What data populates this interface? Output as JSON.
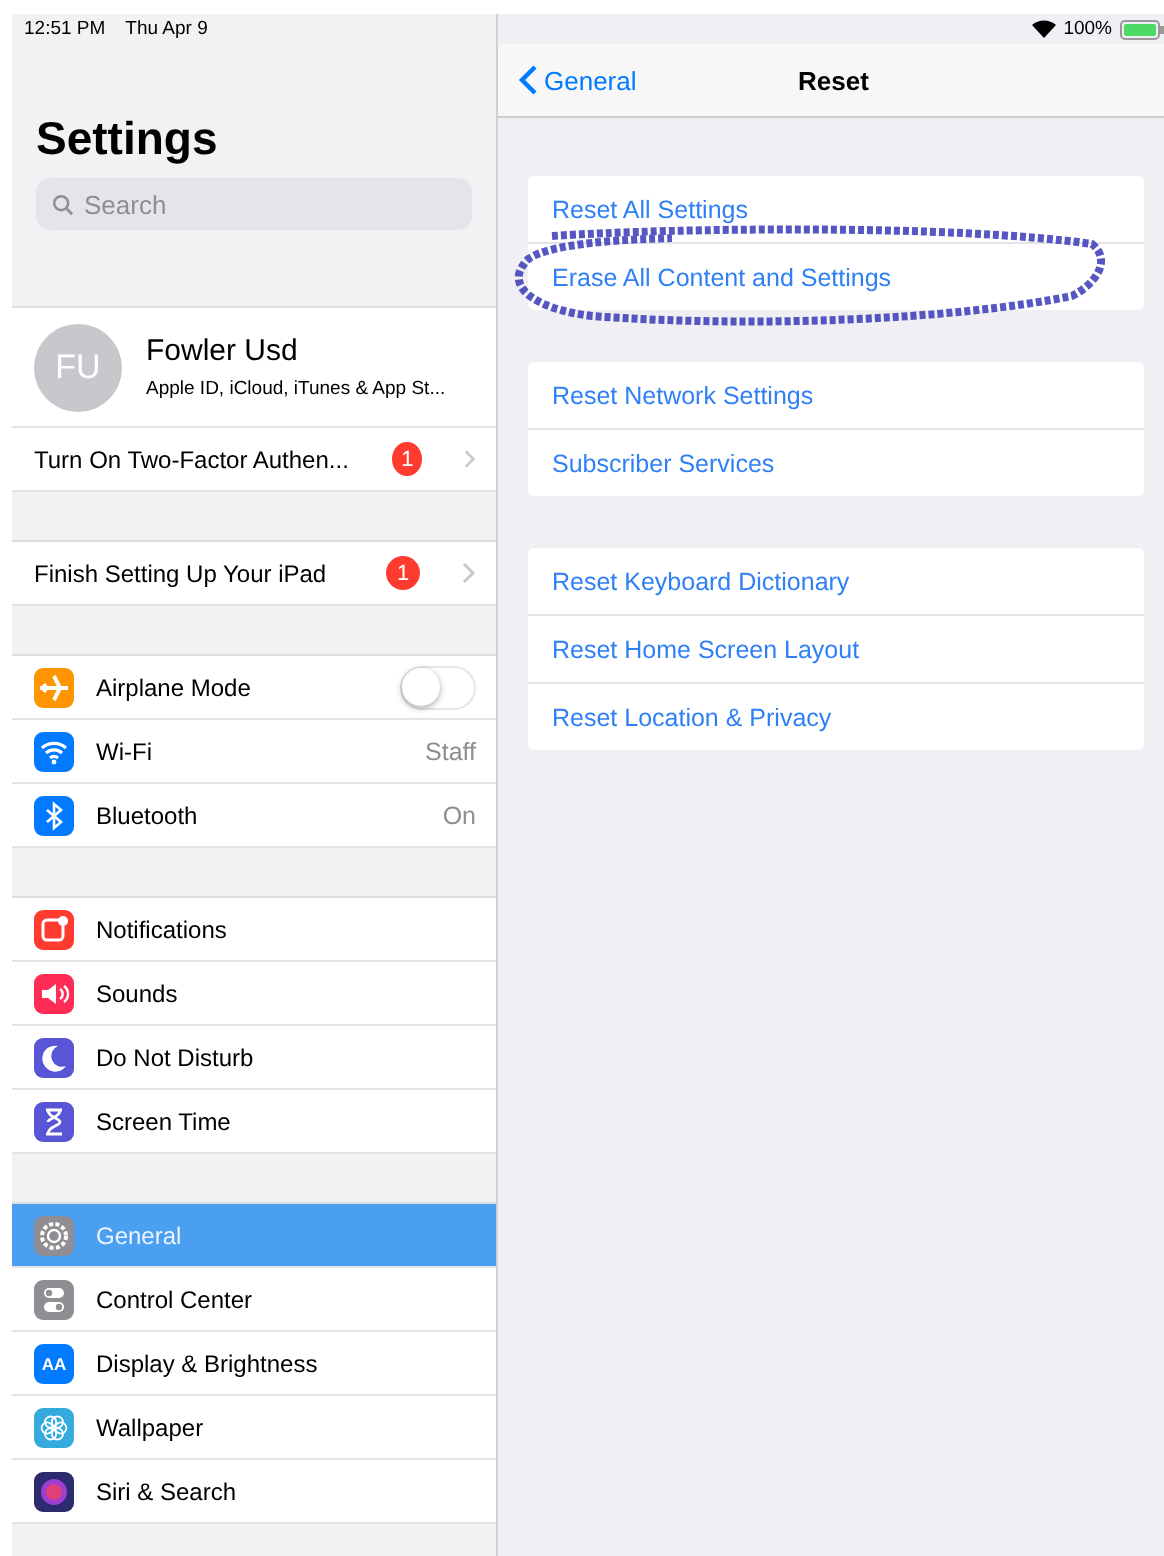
{
  "status_bar": {
    "time": "12:51 PM",
    "date": "Thu Apr 9",
    "battery": "100%"
  },
  "sidebar": {
    "title": "Settings",
    "search": {
      "placeholder": "Search"
    },
    "groups": [
      {
        "items": [
          {
            "kind": "profile",
            "initials": "FU",
            "name": "Fowler Usd",
            "subtitle": "Apple ID, iCloud, iTunes & App St...",
            "selected": false
          },
          {
            "kind": "badge",
            "label": "Turn On Two-Factor Authen...",
            "badge": "1",
            "selected": false
          }
        ]
      },
      {
        "items": [
          {
            "kind": "badge",
            "label": "Finish Setting Up Your iPad",
            "badge": "1",
            "selected": false
          }
        ]
      },
      {
        "items": [
          {
            "kind": "toggle",
            "label": "Airplane Mode",
            "color": "#ff9500",
            "on": false,
            "selected": false
          },
          {
            "kind": "value",
            "label": "Wi-Fi",
            "color": "#007aff",
            "value": "Staff",
            "selected": false
          },
          {
            "kind": "value",
            "label": "Bluetooth",
            "color": "#007aff",
            "value": "On",
            "selected": false
          }
        ]
      },
      {
        "items": [
          {
            "kind": "link",
            "label": "Notifications",
            "color": "#ff3b30",
            "selected": false
          },
          {
            "kind": "link",
            "label": "Sounds",
            "color": "#ff2d55",
            "selected": false
          },
          {
            "kind": "link",
            "label": "Do Not Disturb",
            "color": "#5856d6",
            "selected": false
          },
          {
            "kind": "link",
            "label": "Screen Time",
            "color": "#5856d6",
            "selected": false
          }
        ]
      },
      {
        "items": [
          {
            "kind": "link",
            "label": "General",
            "color": "#8e8e93",
            "selected": true
          },
          {
            "kind": "link",
            "label": "Control Center",
            "color": "#8e8e93",
            "selected": false
          },
          {
            "kind": "link",
            "label": "Display & Brightness",
            "color": "#007aff",
            "icon_text": "AA",
            "selected": false
          },
          {
            "kind": "link",
            "label": "Wallpaper",
            "color": "#35aadc",
            "selected": false
          },
          {
            "kind": "link",
            "label": "Siri & Search",
            "color": "#2b2b6e",
            "selected": false
          }
        ]
      }
    ]
  },
  "detail": {
    "back": "General",
    "title": "Reset",
    "groups": [
      {
        "items": [
          {
            "label": "Reset All Settings",
            "circled": false
          },
          {
            "label": "Erase All Content and Settings",
            "circled": true
          }
        ]
      },
      {
        "items": [
          {
            "label": "Reset Network Settings",
            "circled": false
          },
          {
            "label": "Subscriber Services",
            "circled": false
          }
        ]
      },
      {
        "items": [
          {
            "label": "Reset Keyboard Dictionary",
            "circled": false
          },
          {
            "label": "Reset Home Screen Layout",
            "circled": false
          },
          {
            "label": "Reset Location & Privacy",
            "circled": false
          }
        ]
      }
    ]
  }
}
